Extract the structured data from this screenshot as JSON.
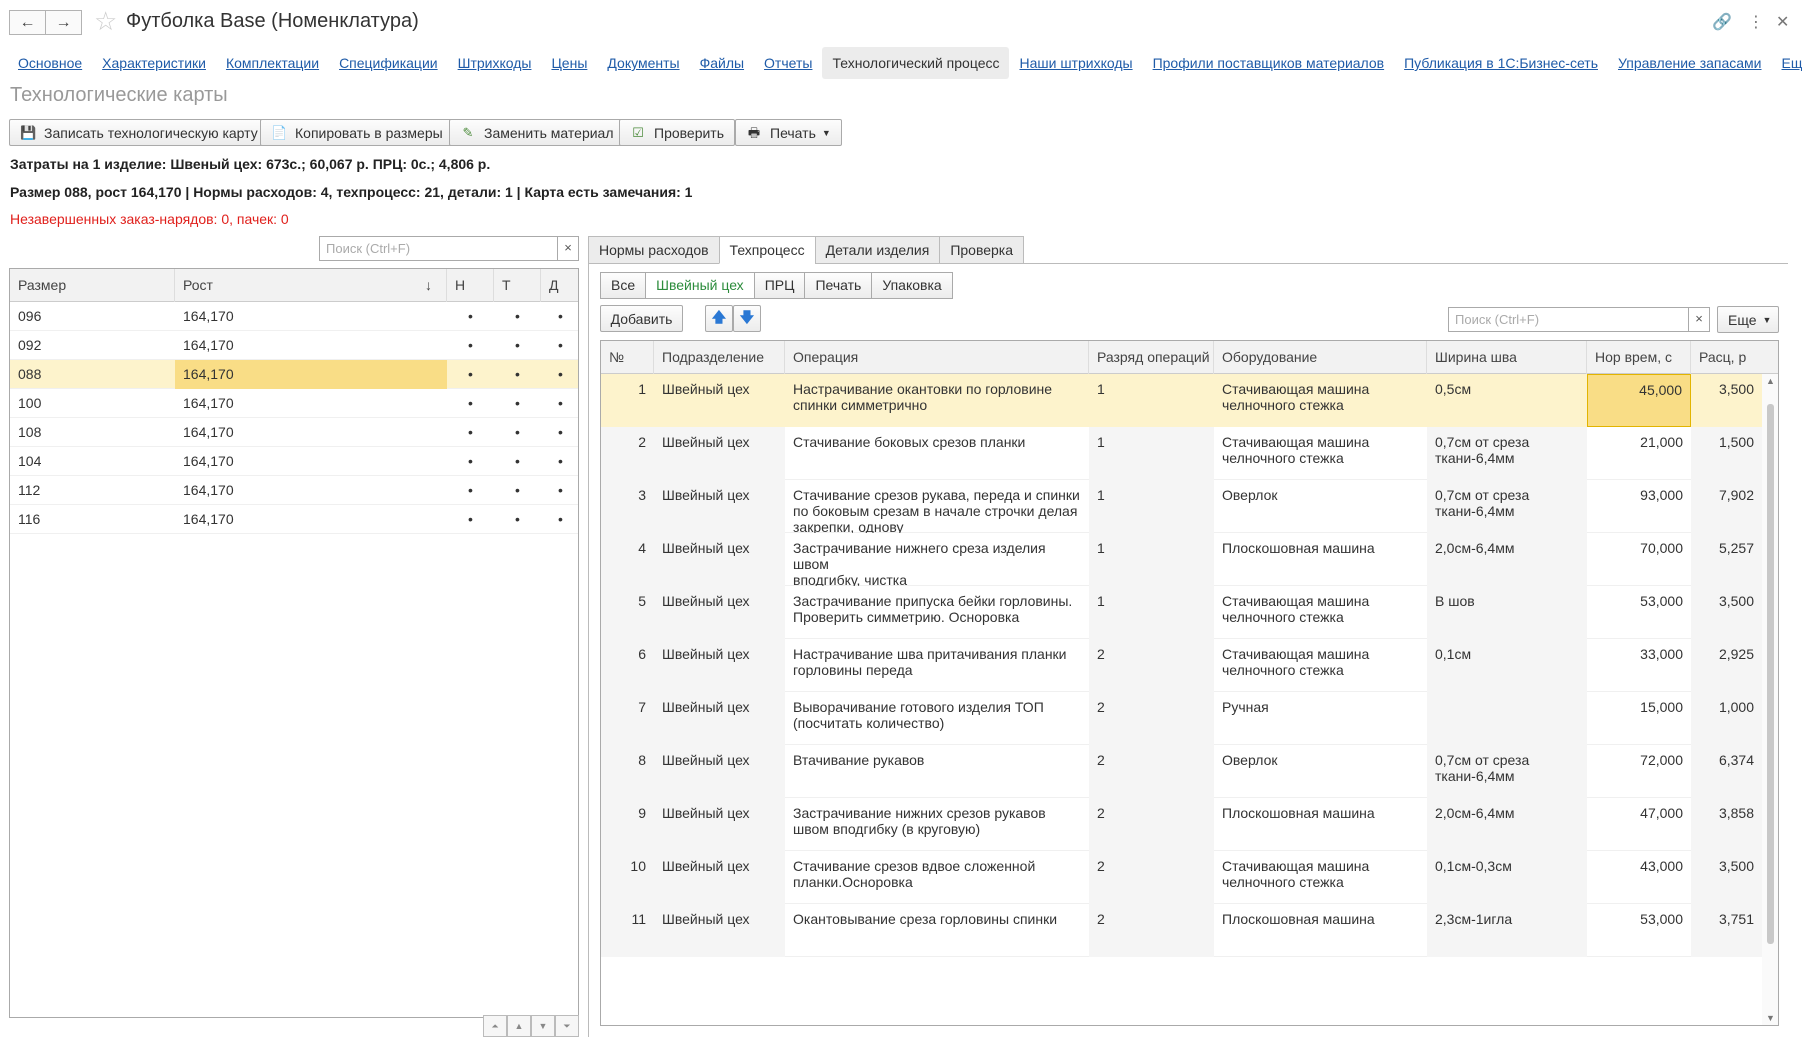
{
  "window": {
    "title": "Футболка Base (Номенклатура)",
    "back_icon": "←",
    "forward_icon": "→"
  },
  "nav": [
    "Основное",
    "Характеристики",
    "Комплектации",
    "Спецификации",
    "Штрихкоды",
    "Цены",
    "Документы",
    "Файлы",
    "Отчеты",
    "Технологический процесс",
    "Наши штрихкоды",
    "Профили поставщиков материалов",
    "Публикация в 1С:Бизнес-сеть",
    "Управление запасами",
    "Еще..."
  ],
  "nav_active_index": 9,
  "section_title": "Технологические карты",
  "toolbar": {
    "save": "Записать технологическую карту",
    "copy": "Копировать в размеры",
    "replace": "Заменить материал",
    "check": "Проверить",
    "print": "Печать"
  },
  "info": {
    "costs": "Затраты на 1 изделие: Швеный цех: 673с.; 60,067 р. ПРЦ: 0с.; 4,806 р.",
    "summary": "Размер 088, рост 164,170 | Нормы расходов: 4, техпроцесс: 21, детали: 1 | Карта есть замечания: 1",
    "warning": "Незавершенных заказ-нарядов: 0, пачек: 0"
  },
  "left": {
    "search_placeholder": "Поиск (Ctrl+F)",
    "headers": {
      "size": "Размер",
      "height": "Рост",
      "sort": "↓",
      "n": "Н",
      "t": "Т",
      "d": "Д"
    },
    "rows": [
      {
        "size": "096",
        "height": "164,170",
        "n": "•",
        "t": "•",
        "d": "•"
      },
      {
        "size": "092",
        "height": "164,170",
        "n": "•",
        "t": "•",
        "d": "•"
      },
      {
        "size": "088",
        "height": "164,170",
        "n": "•",
        "t": "•",
        "d": "•"
      },
      {
        "size": "100",
        "height": "164,170",
        "n": "•",
        "t": "•",
        "d": "•"
      },
      {
        "size": "108",
        "height": "164,170",
        "n": "•",
        "t": "•",
        "d": "•"
      },
      {
        "size": "104",
        "height": "164,170",
        "n": "•",
        "t": "•",
        "d": "•"
      },
      {
        "size": "112",
        "height": "164,170",
        "n": "•",
        "t": "•",
        "d": "•"
      },
      {
        "size": "116",
        "height": "164,170",
        "n": "•",
        "t": "•",
        "d": "•"
      }
    ],
    "selected_index": 2
  },
  "right": {
    "tabs": [
      "Нормы расходов",
      "Техпроцесс",
      "Детали изделия",
      "Проверка"
    ],
    "active_tab": 1,
    "filters": [
      "Все",
      "Швейный цех",
      "ПРЦ",
      "Печать",
      "Упаковка"
    ],
    "active_filter": 1,
    "add_button": "Добавить",
    "search_placeholder": "Поиск (Ctrl+F)",
    "more_button": "Еще",
    "headers": {
      "no": "№",
      "dept": "Подразделение",
      "op": "Операция",
      "rank": "Разряд операций",
      "equip": "Оборудование",
      "seam": "Ширина шва",
      "time": "Нор врем, с",
      "rate": "Расц, р"
    },
    "rows": [
      {
        "no": "1",
        "dept": "Швейный цех",
        "op": " Настрачивание  окантовки по горловине\nспинки симметрично",
        "rank": "1",
        "equip": "Стачивающая машина\nчелночного стежка",
        "seam": "0,5см",
        "time": "45,000",
        "rate": "3,500"
      },
      {
        "no": "2",
        "dept": "Швейный цех",
        "op": " Стачивание боковых срезов планки",
        "rank": "1",
        "equip": "Стачивающая машина\nчелночного стежка",
        "seam": "0,7см от среза\nткани-6,4мм",
        "time": "21,000",
        "rate": "1,500"
      },
      {
        "no": "3",
        "dept": "Швейный цех",
        "op": " Стачивание срезов рукава, переда и спинки\nпо боковым срезам в начале строчки делая\nзакрепки, однову",
        "rank": "1",
        "equip": "Оверлок",
        "seam": "0,7см от среза\nткани-6,4мм",
        "time": "93,000",
        "rate": "7,902"
      },
      {
        "no": "4",
        "dept": "Швейный цех",
        "op": " Застрачивание нижнего среза изделия швом\nвподгибку, чистка",
        "rank": "1",
        "equip": "Плоскошовная машина",
        "seam": "2,0см-6,4мм",
        "time": "70,000",
        "rate": "5,257"
      },
      {
        "no": "5",
        "dept": "Швейный цех",
        "op": " Застрачивание припуска бейки горловины.\nПроверить симметрию. Осноровка",
        "rank": "1",
        "equip": "Стачивающая машина\nчелночного стежка",
        "seam": "В шов",
        "time": "53,000",
        "rate": "3,500"
      },
      {
        "no": "6",
        "dept": "Швейный цех",
        "op": " Настрачивание шва притачивания планки\nгорловины переда",
        "rank": "2",
        "equip": "Стачивающая машина\nчелночного стежка",
        "seam": "0,1см",
        "time": "33,000",
        "rate": "2,925"
      },
      {
        "no": "7",
        "dept": "Швейный цех",
        "op": " Выворачивание готового изделия ТОП\n(посчитать количество)",
        "rank": "2",
        "equip": "Ручная",
        "seam": "",
        "time": "15,000",
        "rate": "1,000"
      },
      {
        "no": "8",
        "dept": "Швейный цех",
        "op": " Втачивание рукавов",
        "rank": "2",
        "equip": "Оверлок",
        "seam": "0,7см от среза\nткани-6,4мм",
        "time": "72,000",
        "rate": "6,374"
      },
      {
        "no": "9",
        "dept": "Швейный цех",
        "op": " Застрачивание нижних  срезов  рукавов\nшвом вподгибку (в круговую)",
        "rank": "2",
        "equip": "Плоскошовная машина",
        "seam": "2,0см-6,4мм",
        "time": "47,000",
        "rate": "3,858"
      },
      {
        "no": "10",
        "dept": "Швейный цех",
        "op": " Стачивание срезов вдвое сложенной\nпланки.Осноровка",
        "rank": "2",
        "equip": "Стачивающая машина\nчелночного стежка",
        "seam": "0,1см-0,3см",
        "time": "43,000",
        "rate": "3,500"
      },
      {
        "no": "11",
        "dept": "Швейный цех",
        "op": " Окантовывание среза горловины спинки",
        "rank": "2",
        "equip": "Плоскошовная машина",
        "seam": "2,3см-1игла",
        "time": "53,000",
        "rate": "3,751"
      }
    ],
    "selected_index": 0
  }
}
